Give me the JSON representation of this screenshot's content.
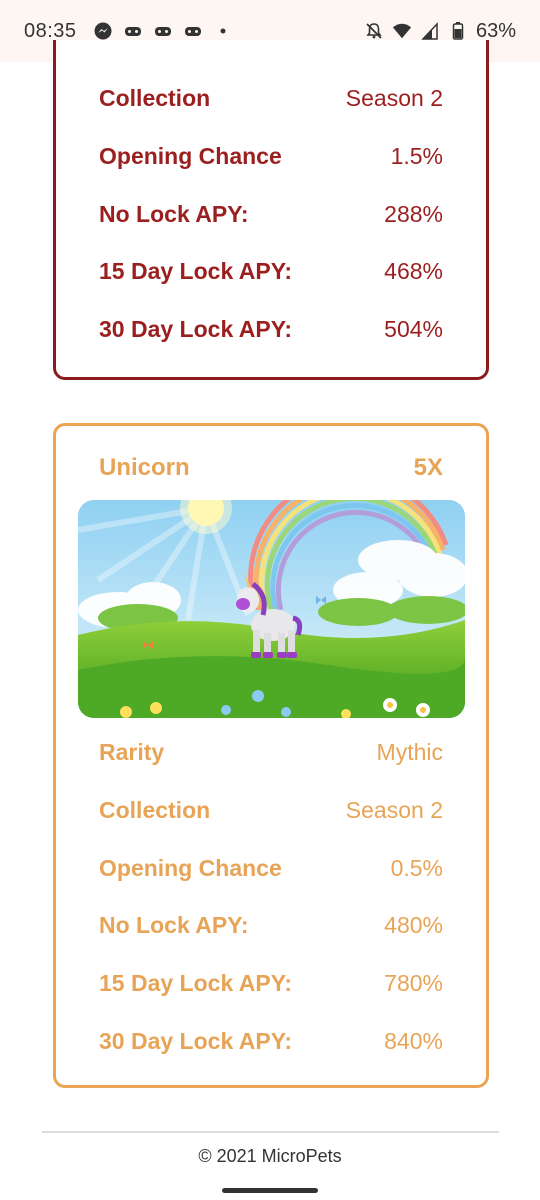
{
  "status_bar": {
    "time": "08:35",
    "notification_icons": [
      "messenger-icon",
      "game-controller-icon",
      "game-controller-icon",
      "game-controller-icon",
      "dot-icon"
    ],
    "right_icons": [
      "notifications-off-icon",
      "wifi-icon",
      "signal-icon",
      "battery-icon"
    ],
    "battery": "63%"
  },
  "top_card": {
    "border_color": "#8b1c1c",
    "text_color": "#9b1f1f",
    "rows": [
      {
        "label": "Collection",
        "value": "Season 2"
      },
      {
        "label": "Opening Chance",
        "value": "1.5%"
      },
      {
        "label": "No Lock APY:",
        "value": "288%"
      },
      {
        "label": "15 Day Lock APY:",
        "value": "468%"
      },
      {
        "label": "30 Day Lock APY:",
        "value": "504%"
      }
    ]
  },
  "unicorn_card": {
    "border_color": "#eaa453",
    "text_color": "#e8a456",
    "name": "Unicorn",
    "multiplier": "5X",
    "rows": [
      {
        "label": "Rarity",
        "value": "Mythic"
      },
      {
        "label": "Collection",
        "value": "Season 2"
      },
      {
        "label": "Opening Chance",
        "value": "0.5%"
      },
      {
        "label": "No Lock APY:",
        "value": "480%"
      },
      {
        "label": "15 Day Lock APY:",
        "value": "780%"
      },
      {
        "label": "30 Day Lock APY:",
        "value": "840%"
      }
    ]
  },
  "footer": {
    "copyright": "© 2021 MicroPets"
  }
}
